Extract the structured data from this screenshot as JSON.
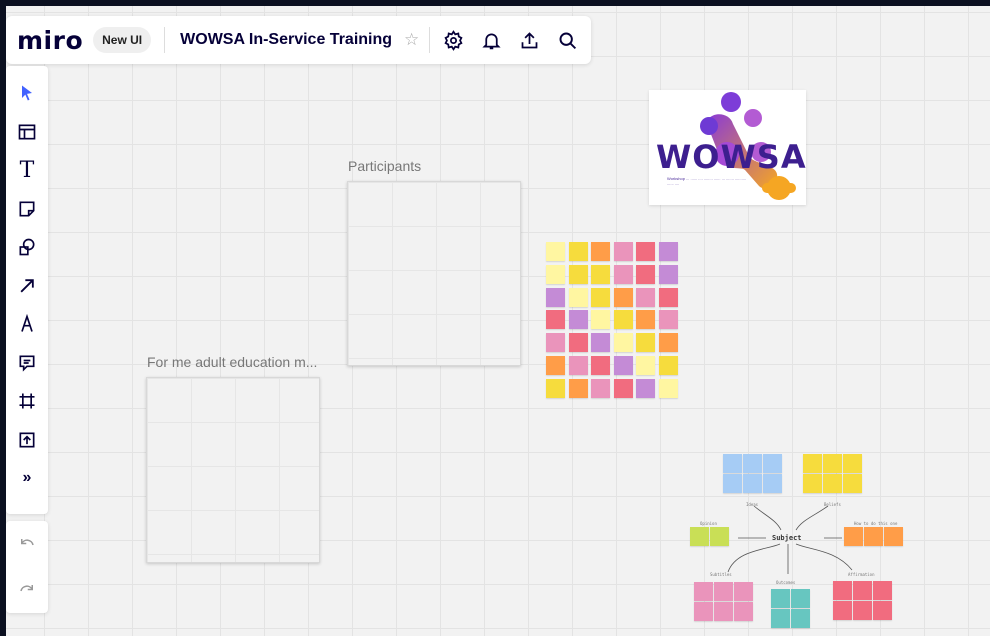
{
  "header": {
    "logo": "miro",
    "new_ui_label": "New UI",
    "board_title": "WOWSA In-Service Training",
    "icons": [
      "star-icon",
      "settings-icon",
      "bell-icon",
      "share-icon",
      "search-icon"
    ]
  },
  "toolbar": {
    "tools": [
      "select-icon",
      "templates-icon",
      "text-icon",
      "sticky-note-icon",
      "shapes-icon",
      "arrow-icon",
      "pen-icon",
      "comment-icon",
      "frame-icon",
      "upload-icon",
      "more-icon"
    ],
    "text_tool_glyph": "T",
    "more_glyph": "»",
    "undo": "undo-icon",
    "redo": "redo-icon"
  },
  "board": {
    "frame_participants_label": "Participants",
    "frame_adult_ed_label": "For me adult education m...",
    "wowsa_logo_word": "WOWSA",
    "wowsa_tagline": "Workshop ... ...... .... ........ ...... ... ....... .......... ...... ....",
    "sticky_colors": {
      "yellow": "#f6dc3d",
      "light_yellow": "#fff6a1",
      "orange": "#ff9d48",
      "pink": "#ea94bb",
      "red": "#f16c7f",
      "purple": "#c48bd6",
      "blue": "#a6ccf5",
      "teal": "#67c6c0",
      "lime": "#c9df56"
    },
    "mindmap": {
      "subject": "Subject",
      "branch_top_left": "Ideas",
      "branch_top_right": "Beliefs",
      "branch_left": "Opinion",
      "branch_right": "How to do this one",
      "branch_bottom_left": "Subtitles",
      "branch_bottom_center": "Outcomes",
      "branch_bottom_right": "Affirmation"
    }
  }
}
